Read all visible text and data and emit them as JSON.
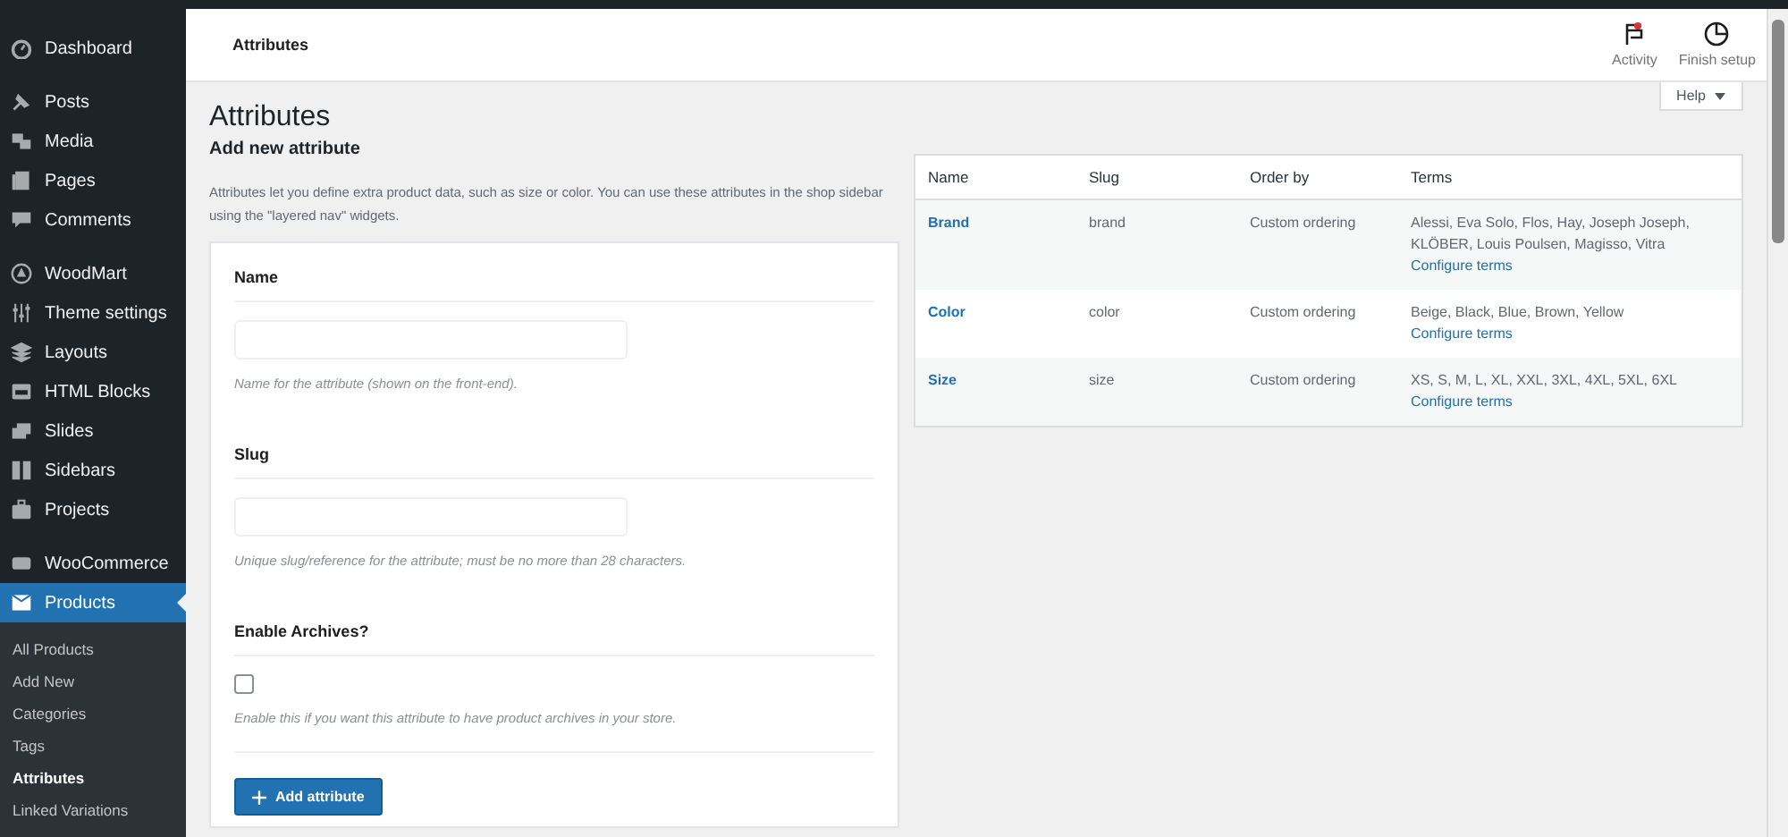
{
  "sidebar": {
    "menu_groups": [
      [
        {
          "label": "Dashboard",
          "selected": false
        }
      ],
      [
        {
          "label": "Posts",
          "selected": false
        },
        {
          "label": "Media",
          "selected": false
        },
        {
          "label": "Pages",
          "selected": false
        },
        {
          "label": "Comments",
          "selected": false
        }
      ],
      [
        {
          "label": "WoodMart",
          "selected": false
        },
        {
          "label": "Theme settings",
          "selected": false
        },
        {
          "label": "Layouts",
          "selected": false
        },
        {
          "label": "HTML Blocks",
          "selected": false
        },
        {
          "label": "Slides",
          "selected": false
        },
        {
          "label": "Sidebars",
          "selected": false
        },
        {
          "label": "Projects",
          "selected": false
        }
      ],
      [
        {
          "label": "WooCommerce",
          "selected": false
        },
        {
          "label": "Products",
          "selected": true
        }
      ]
    ],
    "submenu": [
      {
        "label": "All Products",
        "selected": false
      },
      {
        "label": "Add New",
        "selected": false
      },
      {
        "label": "Categories",
        "selected": false
      },
      {
        "label": "Tags",
        "selected": false
      },
      {
        "label": "Attributes",
        "selected": true
      },
      {
        "label": "Linked Variations",
        "selected": false
      }
    ]
  },
  "header": {
    "title": "Attributes",
    "actions": [
      {
        "label": "Activity",
        "alert": true
      },
      {
        "label": "Finish setup",
        "alert": false
      }
    ],
    "help": "Help"
  },
  "form": {
    "title": "Attributes",
    "subtitle": "Add new attribute",
    "intro": "Attributes let you define extra product data, such as size or color. You can use these attributes in the shop sidebar using the \"layered nav\" widgets.",
    "fields": [
      {
        "kind": "text",
        "label": "Name",
        "help": "Name for the attribute (shown on the front-end)."
      },
      {
        "kind": "text",
        "label": "Slug",
        "help": "Unique slug/reference for the attribute; must be no more than 28 characters."
      },
      {
        "kind": "checkbox",
        "label": "Enable Archives?",
        "checked": false,
        "help": "Enable this if you want this attribute to have product archives in your store."
      }
    ],
    "button": "Add attribute"
  },
  "table": {
    "columns": [
      "Name",
      "Slug",
      "Order by",
      "Terms"
    ],
    "rows": [
      {
        "name": "Brand",
        "slug": "brand",
        "order_by": "Custom ordering",
        "terms": "Alessi, Eva Solo, Flos, Hay, Joseph Joseph, KLÖBER, Louis Poulsen, Magisso, Vitra",
        "link": "Configure terms"
      },
      {
        "name": "Color",
        "slug": "color",
        "order_by": "Custom ordering",
        "terms": "Beige, Black, Blue, Brown, Yellow",
        "link": "Configure terms"
      },
      {
        "name": "Size",
        "slug": "size",
        "order_by": "Custom ordering",
        "terms": "XS, S, M, L, XL, XXL, 3XL, 4XL, 5XL, 6XL",
        "link": "Configure terms"
      }
    ]
  }
}
